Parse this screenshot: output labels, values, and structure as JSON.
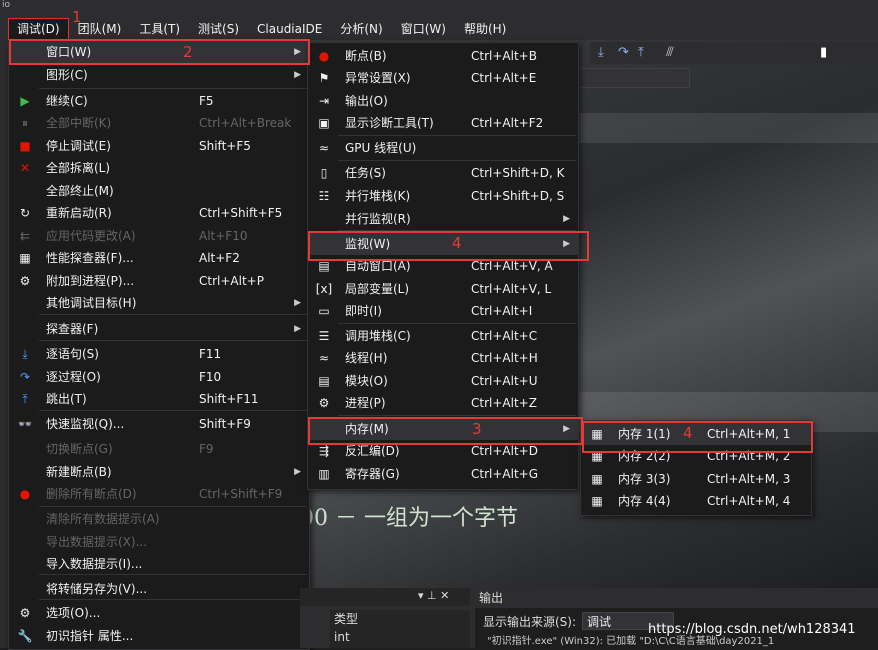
{
  "window": {
    "corner_text": "io"
  },
  "menubar": {
    "items": [
      "调试(D)",
      "团队(M)",
      "工具(T)",
      "测试(S)",
      "ClaudiaIDE",
      "分析(N)",
      "窗口(W)",
      "帮助(H)"
    ]
  },
  "annotations": [
    "1",
    "2",
    "3",
    "4",
    "4"
  ],
  "debug_menu": {
    "items": [
      {
        "label": "窗口(W)",
        "shortcut": "",
        "icon": "",
        "submenu": true
      },
      {
        "label": "图形(C)",
        "shortcut": "",
        "icon": "",
        "submenu": true
      },
      {
        "label": "继续(C)",
        "shortcut": "F5",
        "icon": "▶"
      },
      {
        "label": "全部中断(K)",
        "shortcut": "Ctrl+Alt+Break",
        "icon": "⏸",
        "disabled": true
      },
      {
        "label": "停止调试(E)",
        "shortcut": "Shift+F5",
        "icon": "■"
      },
      {
        "label": "全部拆离(L)",
        "shortcut": "",
        "icon": "✕"
      },
      {
        "label": "全部终止(M)",
        "shortcut": "",
        "icon": ""
      },
      {
        "label": "重新启动(R)",
        "shortcut": "Ctrl+Shift+F5",
        "icon": "↻"
      },
      {
        "label": "应用代码更改(A)",
        "shortcut": "Alt+F10",
        "icon": "⇇",
        "disabled": true
      },
      {
        "label": "性能探查器(F)...",
        "shortcut": "Alt+F2",
        "icon": "▦"
      },
      {
        "label": "附加到进程(P)...",
        "shortcut": "Ctrl+Alt+P",
        "icon": "⚙"
      },
      {
        "label": "其他调试目标(H)",
        "shortcut": "",
        "icon": "",
        "submenu": true
      },
      {
        "label": "探查器(F)",
        "shortcut": "",
        "icon": "",
        "submenu": true
      },
      {
        "label": "逐语句(S)",
        "shortcut": "F11",
        "icon": "⤓"
      },
      {
        "label": "逐过程(O)",
        "shortcut": "F10",
        "icon": "↷"
      },
      {
        "label": "跳出(T)",
        "shortcut": "Shift+F11",
        "icon": "⤒"
      },
      {
        "label": "快速监视(Q)...",
        "shortcut": "Shift+F9",
        "icon": "👓"
      },
      {
        "label": "切换断点(G)",
        "shortcut": "F9",
        "icon": "",
        "disabled": true
      },
      {
        "label": "新建断点(B)",
        "shortcut": "",
        "icon": "",
        "submenu": true
      },
      {
        "label": "删除所有断点(D)",
        "shortcut": "Ctrl+Shift+F9",
        "icon": "●",
        "disabled": true
      },
      {
        "label": "清除所有数据提示(A)",
        "shortcut": "",
        "icon": "",
        "disabled": true
      },
      {
        "label": "导出数据提示(X)...",
        "shortcut": "",
        "icon": "",
        "disabled": true
      },
      {
        "label": "导入数据提示(I)...",
        "shortcut": "",
        "icon": ""
      },
      {
        "label": "将转储另存为(V)...",
        "shortcut": "",
        "icon": ""
      },
      {
        "label": "选项(O)...",
        "shortcut": "",
        "icon": "⚙"
      },
      {
        "label": "初识指针 属性...",
        "shortcut": "",
        "icon": "🔧"
      }
    ]
  },
  "window_menu": {
    "items": [
      {
        "label": "断点(B)",
        "shortcut": "Ctrl+Alt+B",
        "icon": "●"
      },
      {
        "label": "异常设置(X)",
        "shortcut": "Ctrl+Alt+E",
        "icon": "⚑"
      },
      {
        "label": "输出(O)",
        "shortcut": "",
        "icon": "⇥"
      },
      {
        "label": "显示诊断工具(T)",
        "shortcut": "Ctrl+Alt+F2",
        "icon": "▣"
      },
      {
        "label": "GPU 线程(U)",
        "shortcut": "",
        "icon": "≈"
      },
      {
        "label": "任务(S)",
        "shortcut": "Ctrl+Shift+D, K",
        "icon": "▯"
      },
      {
        "label": "并行堆栈(K)",
        "shortcut": "Ctrl+Shift+D, S",
        "icon": "☷"
      },
      {
        "label": "并行监视(R)",
        "shortcut": "",
        "icon": "",
        "submenu": true
      },
      {
        "label": "监视(W)",
        "shortcut": "",
        "icon": "",
        "submenu": true
      },
      {
        "label": "自动窗口(A)",
        "shortcut": "Ctrl+Alt+V, A",
        "icon": "▤"
      },
      {
        "label": "局部变量(L)",
        "shortcut": "Ctrl+Alt+V, L",
        "icon": "[x]"
      },
      {
        "label": "即时(I)",
        "shortcut": "Ctrl+Alt+I",
        "icon": "▭"
      },
      {
        "label": "调用堆栈(C)",
        "shortcut": "Ctrl+Alt+C",
        "icon": "☰"
      },
      {
        "label": "线程(H)",
        "shortcut": "Ctrl+Alt+H",
        "icon": "≈"
      },
      {
        "label": "模块(O)",
        "shortcut": "Ctrl+Alt+U",
        "icon": "▤"
      },
      {
        "label": "进程(P)",
        "shortcut": "Ctrl+Alt+Z",
        "icon": "⚙"
      },
      {
        "label": "内存(M)",
        "shortcut": "",
        "icon": "",
        "submenu": true
      },
      {
        "label": "反汇编(D)",
        "shortcut": "Ctrl+Alt+D",
        "icon": "⇶"
      },
      {
        "label": "寄存器(G)",
        "shortcut": "Ctrl+Alt+G",
        "icon": "▥"
      }
    ]
  },
  "memory_menu": {
    "items": [
      {
        "label": "内存 1(1)",
        "shortcut": "Ctrl+Alt+M, 1",
        "icon": "▦"
      },
      {
        "label": "内存 2(2)",
        "shortcut": "Ctrl+Alt+M, 2",
        "icon": "▦"
      },
      {
        "label": "内存 3(3)",
        "shortcut": "Ctrl+Alt+M, 3",
        "icon": "▦"
      },
      {
        "label": "内存 4(4)",
        "shortcut": "Ctrl+Alt+M, 4",
        "icon": "▦"
      }
    ]
  },
  "background": {
    "editor_text": "00 － 一组为一个字节"
  },
  "bottom": {
    "panel_controls": "▾ ⊥ ✕",
    "type_header": "类型",
    "type_value": "int",
    "output_title": "输出",
    "output_source_label": "显示输出来源(S):",
    "output_source_value": "调试",
    "output_line": "\"初识指针.exe\" (Win32): 已加载 \"D:\\C\\C语言基础\\day2021_1"
  },
  "watermark": "https://blog.csdn.net/wh128341"
}
